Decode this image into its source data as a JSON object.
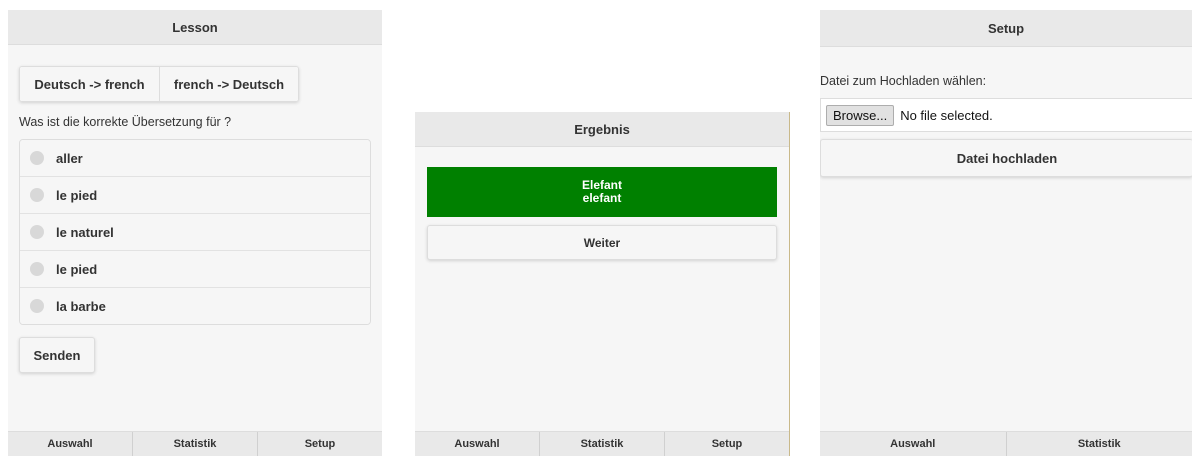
{
  "lesson": {
    "title": "Lesson",
    "direction_options": [
      "Deutsch -> french",
      "french -> Deutsch"
    ],
    "question": "Was ist die korrekte Übersetzung für ?",
    "answers": [
      "aller",
      "le pied",
      "le naturel",
      "le pied",
      "la barbe"
    ],
    "submit_label": "Senden",
    "footer_tabs": [
      "Auswahl",
      "Statistik",
      "Setup"
    ]
  },
  "result": {
    "title": "Ergebnis",
    "answer_line1": "Elefant",
    "answer_line2": "elefant",
    "next_label": "Weiter",
    "footer_tabs": [
      "Auswahl",
      "Statistik",
      "Setup"
    ],
    "correct_color": "#008000"
  },
  "setup": {
    "title": "Setup",
    "file_prompt": "Datei zum Hochladen wählen:",
    "browse_label": "Browse...",
    "file_status": "No file selected.",
    "upload_label": "Datei hochladen",
    "footer_tabs": [
      "Auswahl",
      "Statistik"
    ]
  }
}
